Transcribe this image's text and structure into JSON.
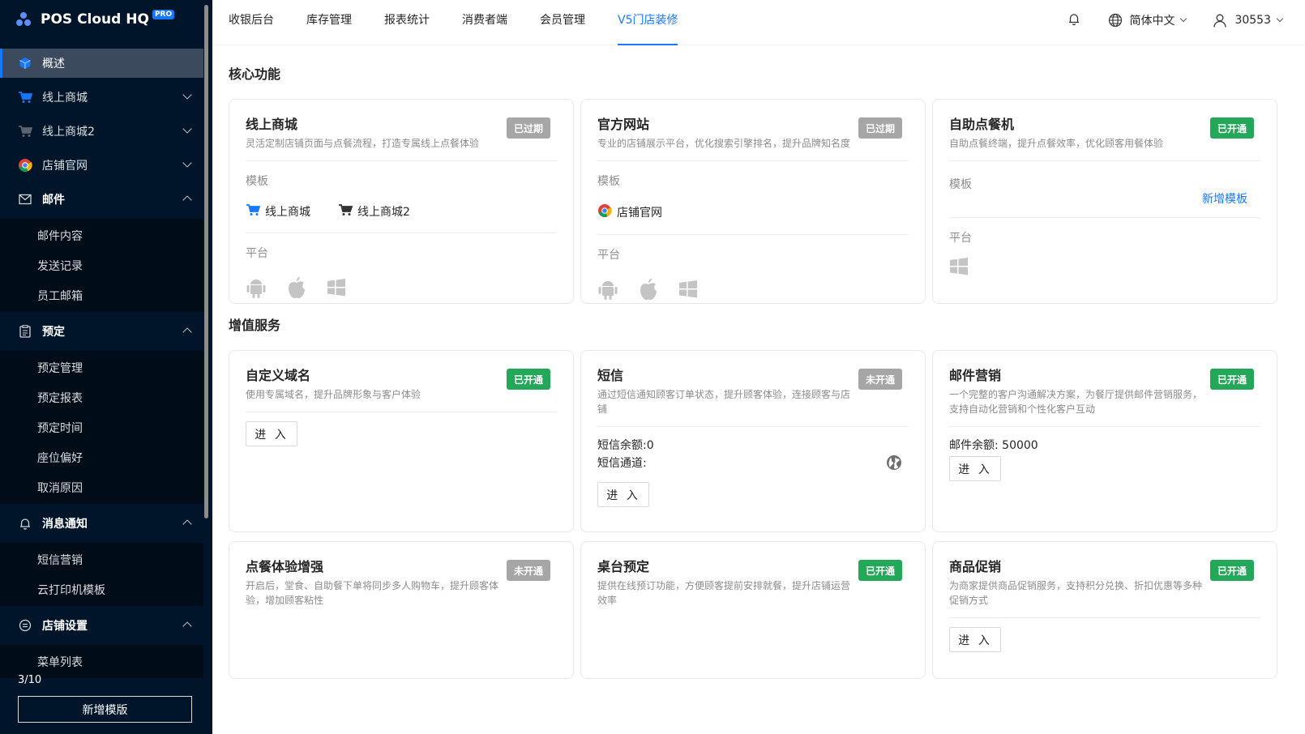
{
  "sidebar": {
    "brand": "POS Cloud HQ",
    "brand_badge": "PRO",
    "items": [
      {
        "label": "概述"
      },
      {
        "label": "线上商城"
      },
      {
        "label": "线上商城2"
      },
      {
        "label": "店铺官网"
      },
      {
        "label": "邮件",
        "children": [
          "邮件内容",
          "发送记录",
          "员工邮箱"
        ]
      },
      {
        "label": "预定",
        "children": [
          "预定管理",
          "预定报表",
          "预定时间",
          "座位偏好",
          "取消原因"
        ]
      },
      {
        "label": "消息通知",
        "children": [
          "短信营销",
          "云打印机模板"
        ]
      },
      {
        "label": "店铺设置",
        "children": [
          "菜单列表"
        ]
      }
    ],
    "footer_count": "3/10",
    "footer_button": "新增模版"
  },
  "topnav": {
    "tabs": [
      "收银后台",
      "库存管理",
      "报表统计",
      "消费者端",
      "会员管理",
      "V5门店装修"
    ],
    "active_tab": "V5门店装修",
    "language": "简体中文",
    "user": "30553"
  },
  "core": {
    "title": "核心功能",
    "template_label": "模板",
    "platform_label": "平台",
    "add_template": "新增模板",
    "cards": [
      {
        "title": "线上商城",
        "desc": "灵活定制店铺页面与点餐流程，打造专属线上点餐体验",
        "badge": "已过期",
        "templates": [
          "线上商城",
          "线上商城2"
        ]
      },
      {
        "title": "官方网站",
        "desc": "专业的店铺展示平台，优化搜索引擎排名，提升品牌知名度",
        "badge": "已过期",
        "templates": [
          "店铺官网"
        ]
      },
      {
        "title": "自助点餐机",
        "desc": "自助点餐终端，提升点餐效率，优化顾客用餐体验",
        "badge": "已开通",
        "templates": []
      }
    ]
  },
  "services": {
    "title": "增值服务",
    "enter_label": "进 入",
    "cards": [
      {
        "title": "自定义域名",
        "desc": "使用专属域名，提升品牌形象与客户体验",
        "badge": "已开通"
      },
      {
        "title": "短信",
        "desc": "通过短信通知顾客订单状态，提升顾客体验，连接顾客与店铺",
        "badge": "未开通",
        "balance": "短信余额:0",
        "channel": "短信通道:"
      },
      {
        "title": "邮件营销",
        "desc": "一个完整的客户沟通解决方案，为餐厅提供邮件营销服务，支持自动化营销和个性化客户互动",
        "badge": "已开通",
        "balance": "邮件余额: 50000"
      },
      {
        "title": "点餐体验增强",
        "desc": "开启后，堂食、自助餐下单将同步多人购物车，提升顾客体验，增加顾客粘性",
        "badge": "未开通"
      },
      {
        "title": "桌台预定",
        "desc": "提供在线预订功能，方便顾客提前安排就餐，提升店铺运营效率",
        "badge": "已开通"
      },
      {
        "title": "商品促销",
        "desc": "为商家提供商品促销服务，支持积分兑换、折扣优惠等多种促销方式",
        "badge": "已开通"
      }
    ]
  },
  "colors": {
    "sidebar_bg": "#001529",
    "accent": "#1677ff",
    "open_badge": "#23a85a",
    "closed_badge": "#a6a6a6"
  }
}
